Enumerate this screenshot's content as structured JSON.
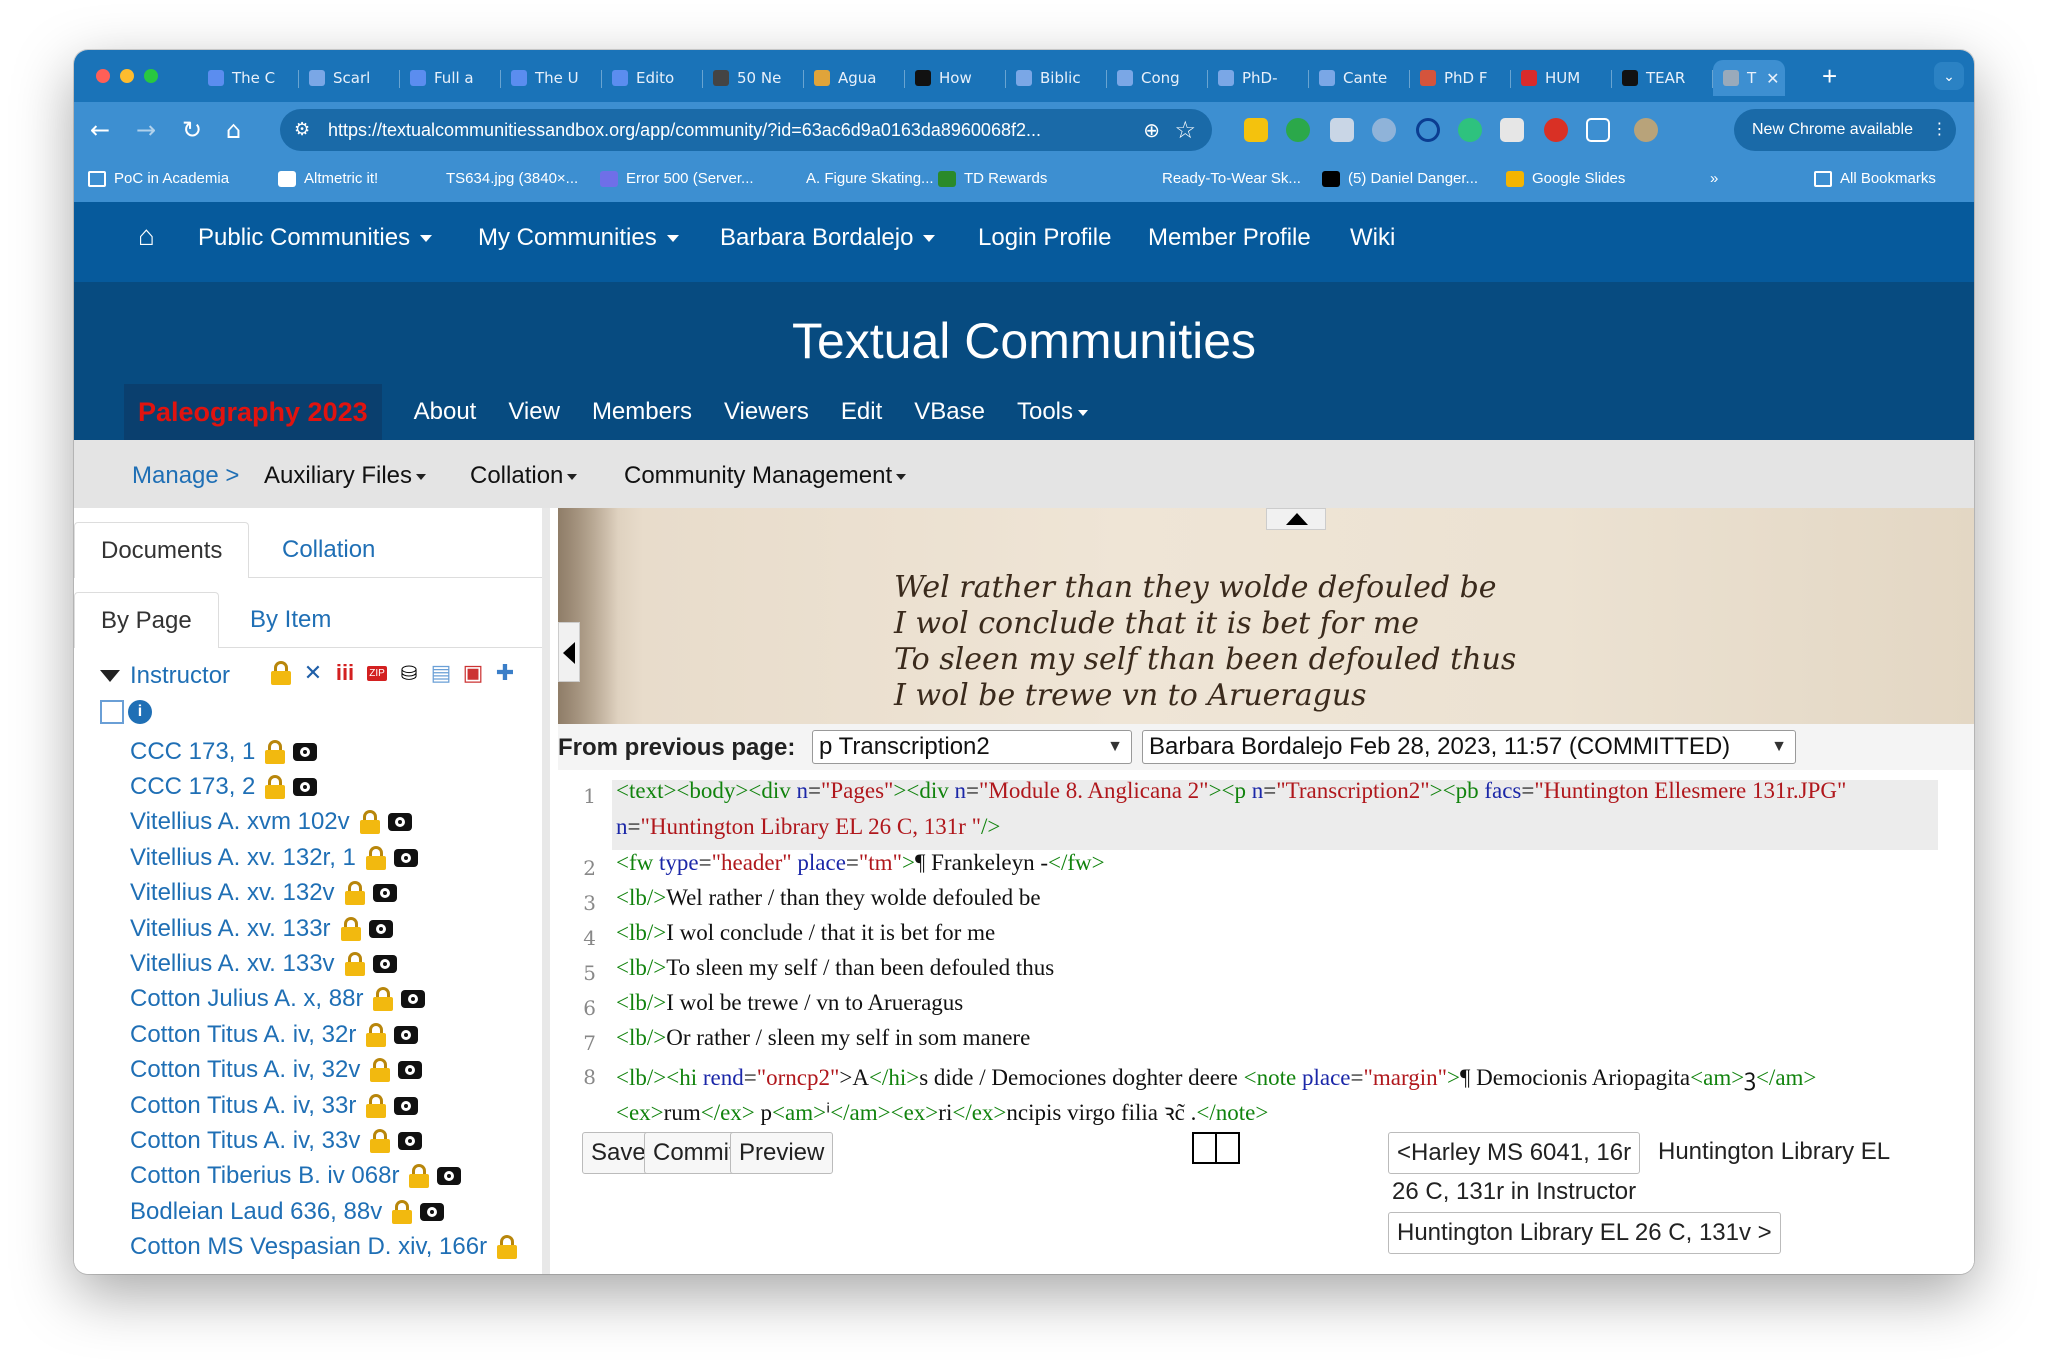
{
  "browser": {
    "tabs": [
      {
        "label": "The C",
        "color": "#5b8def"
      },
      {
        "label": "Scarl",
        "color": "#7aa7e6"
      },
      {
        "label": "Full a",
        "color": "#5b8def"
      },
      {
        "label": "The U",
        "color": "#5b8def"
      },
      {
        "label": "Edito",
        "color": "#5b8def"
      },
      {
        "label": "50 Ne",
        "color": "#444444"
      },
      {
        "label": "Agua",
        "color": "#e0a43a"
      },
      {
        "label": "How",
        "color": "#111111"
      },
      {
        "label": "Biblic",
        "color": "#7aa7e6"
      },
      {
        "label": "Cong",
        "color": "#7aa7e6"
      },
      {
        "label": "PhD-",
        "color": "#7aa7e6"
      },
      {
        "label": "Cante",
        "color": "#7aa7e6"
      },
      {
        "label": "PhD F",
        "color": "#d4543c"
      },
      {
        "label": "HUM",
        "color": "#d92b2b"
      },
      {
        "label": "TEAR",
        "color": "#111111"
      }
    ],
    "active_tab": {
      "label": "T"
    },
    "url": "https://textualcommunitiessandbox.org/app/community/?id=63ac6d9a0163da8960068f2...",
    "new_chrome": "New Chrome available",
    "bookmarks": [
      "PoC in Academia",
      "Altmetric it!",
      "TS634.jpg (3840×...",
      "Error 500 (Server...",
      "A. Figure Skating...",
      "TD Rewards",
      "Ready-To-Wear Sk...",
      "(5) Daniel Danger...",
      "Google Slides",
      "»",
      "All Bookmarks"
    ]
  },
  "site": {
    "nav": {
      "public": "Public Communities",
      "my": "My Communities",
      "user": "Barbara Bordalejo",
      "login": "Login Profile",
      "member": "Member Profile",
      "wiki": "Wiki"
    },
    "title": "Textual Communities",
    "community": "Paleography 2023",
    "subnav": [
      "About",
      "View",
      "Members",
      "Viewers",
      "Edit",
      "VBase",
      "Tools"
    ],
    "manage": {
      "label": "Manage >",
      "aux": "Auxiliary Files",
      "collation": "Collation",
      "community": "Community Management"
    }
  },
  "left": {
    "tabs": {
      "documents": "Documents",
      "collation": "Collation"
    },
    "subtabs": {
      "by_page": "By Page",
      "by_item": "By Item"
    },
    "tree_title": "Instructor",
    "documents": [
      "CCC 173, 1",
      "CCC 173, 2",
      "Vitellius A. xvm 102v",
      "Vitellius A. xv. 132r, 1",
      "Vitellius A. xv. 132v",
      "Vitellius A. xv. 133r",
      "Vitellius A. xv. 133v",
      "Cotton Julius A. x, 88r",
      "Cotton Titus A. iv, 32r",
      "Cotton Titus A. iv, 32v",
      "Cotton Titus A. iv, 33r",
      "Cotton Titus A. iv, 33v",
      "Cotton Tiberius B. iv 068r",
      "Bodleian Laud 636, 88v",
      "Cotton MS Vespasian D. xiv, 166r"
    ]
  },
  "manuscript": {
    "lines": [
      "Wel rather than they wolde defouled be",
      "I wol conclude that it is bet for me",
      "To sleen my self than been defouled thus",
      "I wol be trewe vn to Arueragus"
    ]
  },
  "editor": {
    "prev_label": "From previous page:",
    "prev_select": "p Transcription2",
    "version_select": "Barbara Bordalejo Feb 28, 2023, 11:57 (COMMITTED)",
    "lines": {
      "l1a": [
        "<text><body><div ",
        "n",
        "=",
        "\"Pages\"",
        "><div ",
        "n",
        "=",
        "\"Module 8. Anglicana 2\"",
        "><p ",
        "n",
        "=",
        "\"Transcription2\"",
        "><pb ",
        "facs",
        "=",
        "\"Huntington Ellesmere 131r.JPG\""
      ],
      "l1b": [
        "n",
        "=",
        "\"Huntington Library EL 26 C, 131r \"",
        "/>"
      ],
      "l2": [
        "<fw ",
        "type",
        "=",
        "\"header\"",
        " ",
        "place",
        "=",
        "\"tm\"",
        ">",
        "¶ Frankeleyn -",
        "</fw>"
      ],
      "l3": [
        "<lb/>",
        "Wel rather / than they wolde defouled be"
      ],
      "l4": [
        "<lb/>",
        "I wol conclude / that it is bet for me"
      ],
      "l5": [
        "<lb/>",
        "To sleen my self / than been defouled thus"
      ],
      "l6": [
        "<lb/>",
        "I wol be trewe / vn to Arueragus"
      ],
      "l7": [
        "<lb/>",
        "Or rather / sleen my self in som manere"
      ],
      "l8a": [
        "<lb/><hi ",
        "rend",
        "=",
        "\"orncp2\"",
        ">A",
        "</hi>",
        "s dide / Demociones doghter deere ",
        "<note ",
        "place",
        "=",
        "\"margin\"",
        ">",
        "¶ Democionis Ariopagita",
        "<am>",
        "ꝫ",
        "</am>"
      ],
      "l8b": [
        "<ex>",
        "rum",
        "</ex>",
        " p",
        "<am>",
        "ⁱ",
        "</am><ex>",
        "ri",
        "</ex>",
        "ncipis virgo filia ꝛc̃ .",
        "</note>"
      ]
    },
    "line_numbers": [
      "1",
      "2",
      "3",
      "4",
      "5",
      "6",
      "7",
      "8"
    ],
    "buttons": {
      "save": "Save",
      "commit": "Commit",
      "preview": "Preview"
    },
    "prev_page": "<Harley MS 6041, 16r",
    "current_a": "Huntington Library EL",
    "current_b": "26 C, 131r in Instructor",
    "next_page": "Huntington Library EL 26 C, 131v >"
  }
}
